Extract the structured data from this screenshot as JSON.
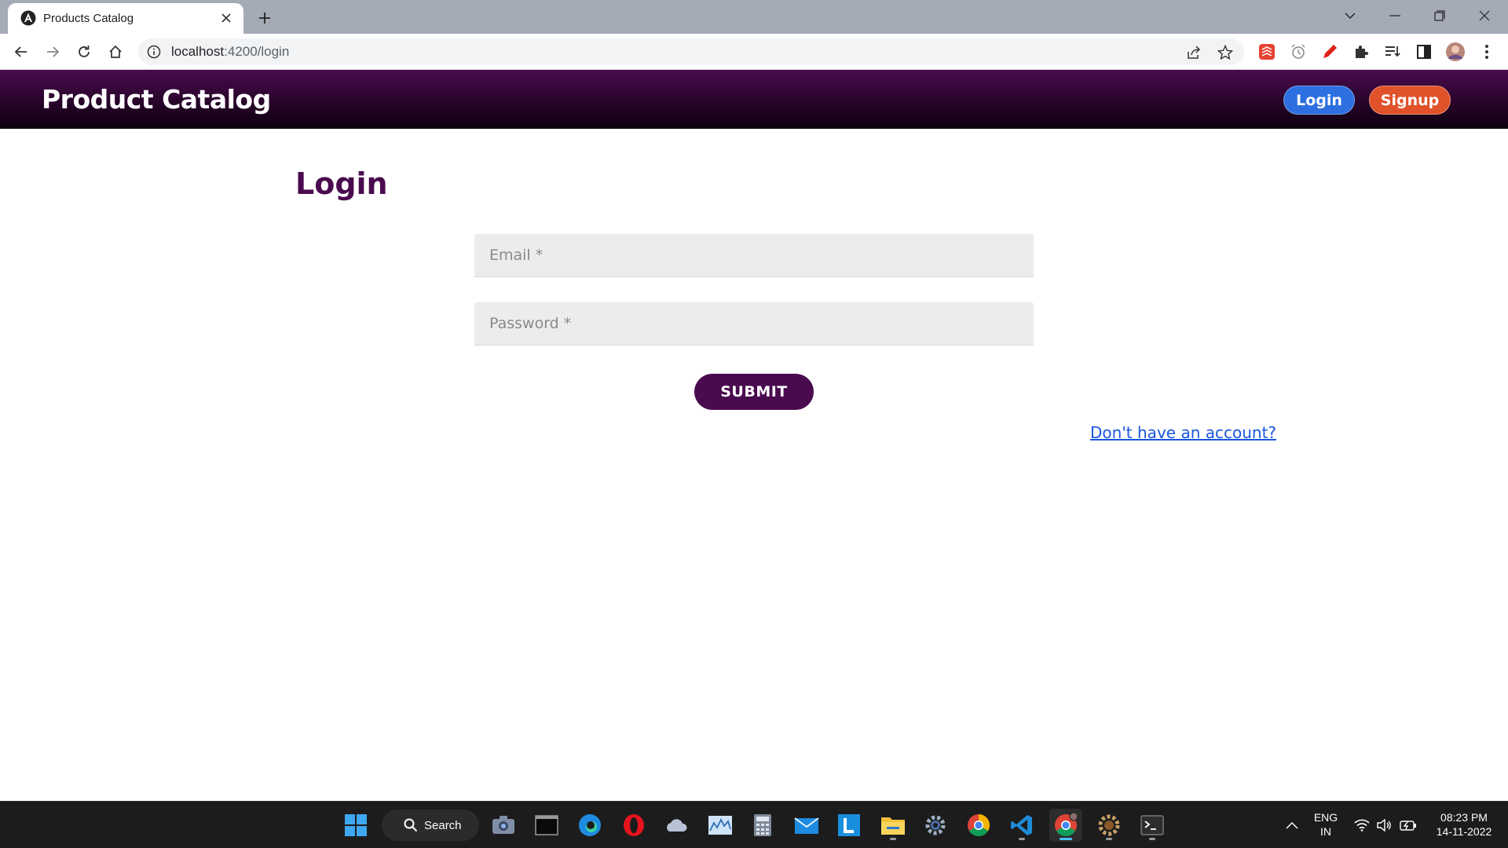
{
  "browser": {
    "tab_title": "Products Catalog",
    "url_host": "localhost",
    "url_rest": ":4200/login"
  },
  "app": {
    "brand": "Product Catalog",
    "nav_login": "Login",
    "nav_signup": "Signup"
  },
  "login_form": {
    "title": "Login",
    "email_placeholder": "Email *",
    "password_placeholder": "Password *",
    "submit_label": "SUBMIT",
    "signup_link": "Don't have an account?"
  },
  "taskbar": {
    "search_label": "Search",
    "language_line1": "ENG",
    "language_line2": "IN",
    "time": "08:23 PM",
    "date": "14-11-2022"
  },
  "colors": {
    "header_top": "#4a0a4e",
    "header_bottom": "#0c000d",
    "primary": "#4a0a4e",
    "login_button": "#2d6fe0",
    "signup_button": "#e0522a",
    "link": "#1a56e0"
  }
}
